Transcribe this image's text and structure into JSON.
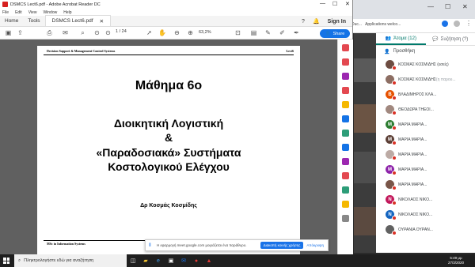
{
  "chrome": {
    "bookmarks": [
      "Duc...",
      "Applications welco..."
    ]
  },
  "meet_panel": {
    "tab_people": "Άτομα (12)",
    "tab_chat": "Συζήτηση (?)",
    "add_label": "Προσθήκη",
    "participants": [
      {
        "name": "ΚΟΣΜΑΣ ΚΟΣΜΙΔΗΣ (εσείς)",
        "initial": "",
        "color": "#6d4c41",
        "muted": ""
      },
      {
        "name": "ΚΟΣΜΑΣ ΚΟΣΜΙΔΗΣ",
        "initial": "",
        "color": "#8d6e63",
        "muted": "(η παρου..."
      },
      {
        "name": "ΒΛΑΔΙΜΗΡΟΣ ΚΛΑ...",
        "initial": "B",
        "color": "#e65100",
        "muted": ""
      },
      {
        "name": "ΘΕΟΔΩΡΑ ΤΗΕΟΙ...",
        "initial": "",
        "color": "#a1887f",
        "muted": ""
      },
      {
        "name": "ΜΑΡΙΑ ΜΑΡΙΑ...",
        "initial": "M",
        "color": "#2e7d32",
        "muted": ""
      },
      {
        "name": "ΜΑΡΙΑ ΜΑΡΙΑ...",
        "initial": "M",
        "color": "#5d4037",
        "muted": ""
      },
      {
        "name": "ΜΑΡΙΑ ΜΑΡΙΑ...",
        "initial": "",
        "color": "#bcaaa4",
        "muted": ""
      },
      {
        "name": "ΜΑΡΙΑ ΜΑΡΙΑ...",
        "initial": "M",
        "color": "#8e24aa",
        "muted": ""
      },
      {
        "name": "ΜΑΡΙΑ ΜΑΡΙΑ...",
        "initial": "",
        "color": "#795548",
        "muted": ""
      },
      {
        "name": "ΝΙΚΟΛΑΟΣ ΝΙΚΟ...",
        "initial": "N",
        "color": "#c2185b",
        "muted": ""
      },
      {
        "name": "ΝΙΚΟΛΑΟΣ ΝΙΚΟ...",
        "initial": "N",
        "color": "#1565c0",
        "muted": ""
      },
      {
        "name": "ΟΥΡΑΝΙΑ ΟΥΡΑΝ...",
        "initial": "",
        "color": "#616161",
        "muted": ""
      }
    ]
  },
  "acrobat": {
    "window_title": "DSMCS Lect6.pdf - Adobe Acrobat Reader DC",
    "menu": [
      "File",
      "Edit",
      "View",
      "Window",
      "Help"
    ],
    "tabs": {
      "home": "Home",
      "tools": "Tools",
      "doc": "DSMCS Lect6.pdf"
    },
    "sign_in": "Sign In",
    "page_current": "1",
    "page_total": "/ 24",
    "zoom": "63,2%",
    "share": "Share"
  },
  "slide": {
    "header_left": "Decision Support & Management Control Systems",
    "header_right": "Lect6",
    "title": "Μάθημα 6ο",
    "line1": "Διοικητική Λογιστική",
    "line2": "&",
    "line3": "«Παραδοσιακά» Συστήματα",
    "line4": "Κοστολογικού Ελέγχου",
    "author": "Δρ Κοσμάς Κοσμίδης",
    "footer": "MSc in Information Systems"
  },
  "meet_notice": {
    "text": "Η εφαρμογή meet.google.com μοιράζεται ένα παράθυρο.",
    "stop": "Διακοπή κοινής χρήσης",
    "hide": "Απόκρυψη"
  },
  "taskbar": {
    "search_placeholder": "Πληκτρολογήστε εδώ για αναζήτηση",
    "time": "5:49 μμ",
    "date": "27/3/2020"
  },
  "colors": {
    "accent": "#1473e6",
    "meet_teal": "#00796b",
    "acrobat_red": "#d7201f"
  }
}
